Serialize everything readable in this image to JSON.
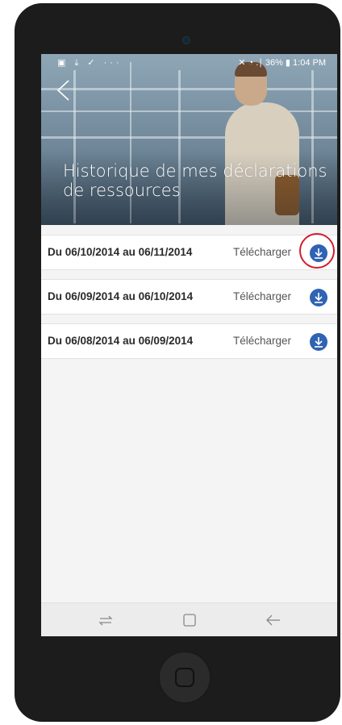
{
  "status_bar": {
    "left_icons": "▣ ⤓ ✓ ···",
    "right_text": "✕ ◔ .∣ 36% ▮ 1:04 PM"
  },
  "header": {
    "title": "Historique de mes déclarations de ressources"
  },
  "declarations": [
    {
      "period": "Du 06/10/2014 au 06/11/2014",
      "action_label": "Télécharger"
    },
    {
      "period": "Du 06/09/2014 au 06/10/2014",
      "action_label": "Télécharger"
    },
    {
      "period": "Du 06/08/2014 au 06/09/2014",
      "action_label": "Télécharger"
    }
  ],
  "colors": {
    "accent": "#2f63b3",
    "highlight": "#cf1f2e"
  },
  "icons": {
    "back": "chevron-left-icon",
    "download": "download-icon",
    "nav_recent": "recent-apps-icon",
    "nav_home": "home-icon",
    "nav_back": "back-arrow-icon"
  }
}
